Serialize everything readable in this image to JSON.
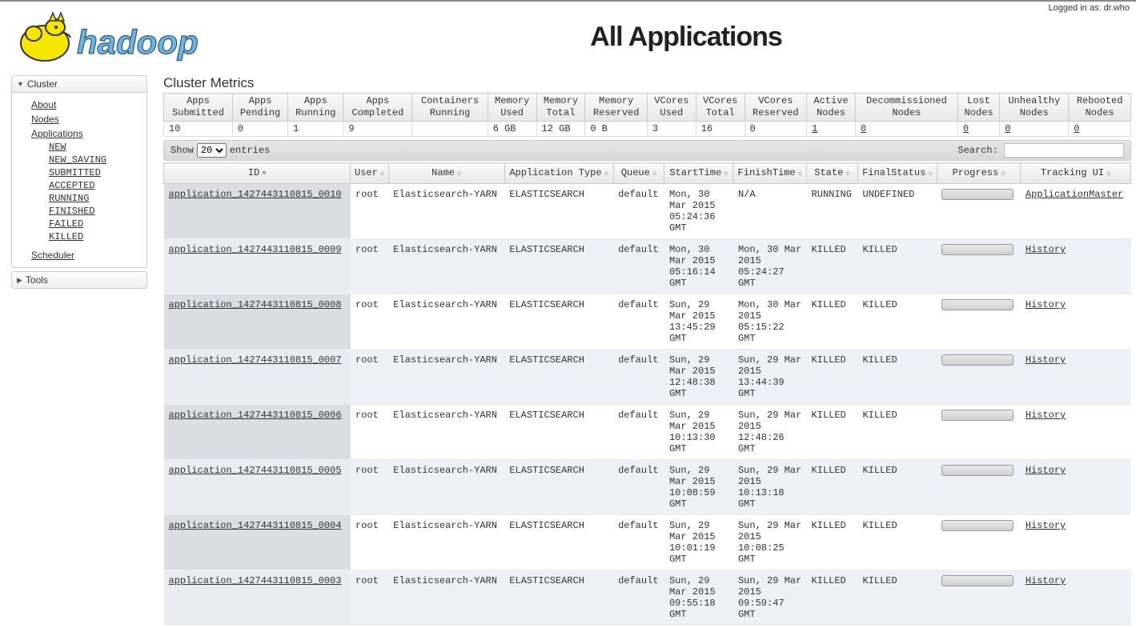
{
  "login_text": "Logged in as: dr.who",
  "page_title": "All Applications",
  "sidebar": {
    "cluster_label": "Cluster",
    "tools_label": "Tools",
    "about": "About",
    "nodes": "Nodes",
    "applications": "Applications",
    "scheduler": "Scheduler",
    "app_states": [
      "NEW",
      "NEW_SAVING",
      "SUBMITTED",
      "ACCEPTED",
      "RUNNING",
      "FINISHED",
      "FAILED",
      "KILLED"
    ]
  },
  "metrics_title": "Cluster Metrics",
  "metrics_headers": [
    "Apps Submitted",
    "Apps Pending",
    "Apps Running",
    "Apps Completed",
    "Containers Running",
    "Memory Used",
    "Memory Total",
    "Memory Reserved",
    "VCores Used",
    "VCores Total",
    "VCores Reserved",
    "Active Nodes",
    "Decommissioned Nodes",
    "Lost Nodes",
    "Unhealthy Nodes",
    "Rebooted Nodes"
  ],
  "metrics_values": [
    "10",
    "0",
    "1",
    "9",
    "",
    "6 GB",
    "12 GB",
    "0 B",
    "3",
    "16",
    "0",
    "1",
    "0",
    "0",
    "0",
    "0"
  ],
  "metrics_links": [
    false,
    false,
    false,
    false,
    false,
    false,
    false,
    false,
    false,
    false,
    false,
    true,
    true,
    true,
    true,
    true
  ],
  "toolbar": {
    "show_label": "Show",
    "entries_label": "entries",
    "page_size": "20",
    "search_label": "Search:"
  },
  "apps_headers": [
    "ID",
    "User",
    "Name",
    "Application Type",
    "Queue",
    "StartTime",
    "FinishTime",
    "State",
    "FinalStatus",
    "Progress",
    "Tracking UI"
  ],
  "apps": [
    {
      "id": "application_1427443110815_0010",
      "user": "root",
      "name": "Elasticsearch-YARN",
      "type": "ELASTICSEARCH",
      "queue": "default",
      "start": "Mon, 30 Mar 2015 05:24:36 GMT",
      "finish": "N/A",
      "state": "RUNNING",
      "final": "UNDEFINED",
      "tracking": "ApplicationMaster"
    },
    {
      "id": "application_1427443110815_0009",
      "user": "root",
      "name": "Elasticsearch-YARN",
      "type": "ELASTICSEARCH",
      "queue": "default",
      "start": "Mon, 30 Mar 2015 05:16:14 GMT",
      "finish": "Mon, 30 Mar 2015 05:24:27 GMT",
      "state": "KILLED",
      "final": "KILLED",
      "tracking": "History"
    },
    {
      "id": "application_1427443110815_0008",
      "user": "root",
      "name": "Elasticsearch-YARN",
      "type": "ELASTICSEARCH",
      "queue": "default",
      "start": "Sun, 29 Mar 2015 13:45:29 GMT",
      "finish": "Mon, 30 Mar 2015 05:15:22 GMT",
      "state": "KILLED",
      "final": "KILLED",
      "tracking": "History"
    },
    {
      "id": "application_1427443110815_0007",
      "user": "root",
      "name": "Elasticsearch-YARN",
      "type": "ELASTICSEARCH",
      "queue": "default",
      "start": "Sun, 29 Mar 2015 12:48:38 GMT",
      "finish": "Sun, 29 Mar 2015 13:44:39 GMT",
      "state": "KILLED",
      "final": "KILLED",
      "tracking": "History"
    },
    {
      "id": "application_1427443110815_0006",
      "user": "root",
      "name": "Elasticsearch-YARN",
      "type": "ELASTICSEARCH",
      "queue": "default",
      "start": "Sun, 29 Mar 2015 10:13:30 GMT",
      "finish": "Sun, 29 Mar 2015 12:48:26 GMT",
      "state": "KILLED",
      "final": "KILLED",
      "tracking": "History"
    },
    {
      "id": "application_1427443110815_0005",
      "user": "root",
      "name": "Elasticsearch-YARN",
      "type": "ELASTICSEARCH",
      "queue": "default",
      "start": "Sun, 29 Mar 2015 10:08:59 GMT",
      "finish": "Sun, 29 Mar 2015 10:13:18 GMT",
      "state": "KILLED",
      "final": "KILLED",
      "tracking": "History"
    },
    {
      "id": "application_1427443110815_0004",
      "user": "root",
      "name": "Elasticsearch-YARN",
      "type": "ELASTICSEARCH",
      "queue": "default",
      "start": "Sun, 29 Mar 2015 10:01:19 GMT",
      "finish": "Sun, 29 Mar 2015 10:08:25 GMT",
      "state": "KILLED",
      "final": "KILLED",
      "tracking": "History"
    },
    {
      "id": "application_1427443110815_0003",
      "user": "root",
      "name": "Elasticsearch-YARN",
      "type": "ELASTICSEARCH",
      "queue": "default",
      "start": "Sun, 29 Mar 2015 09:55:18 GMT",
      "finish": "Sun, 29 Mar 2015 09:59:47 GMT",
      "state": "KILLED",
      "final": "KILLED",
      "tracking": "History"
    }
  ]
}
